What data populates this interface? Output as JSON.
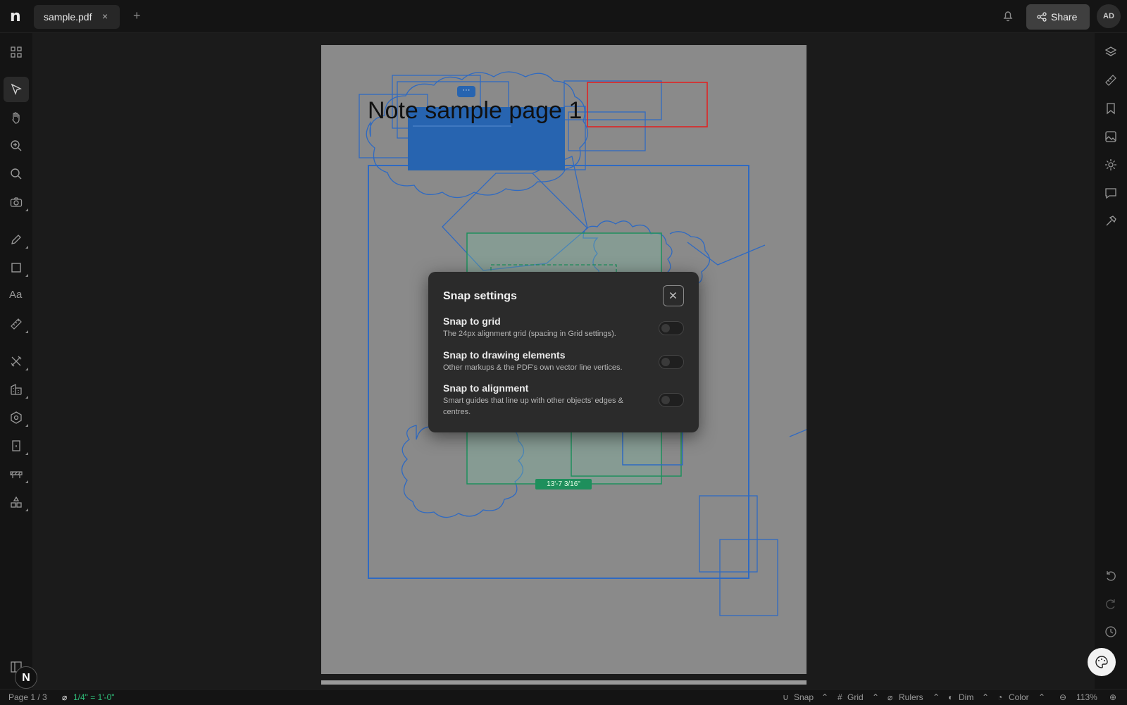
{
  "app": {
    "logo": "n"
  },
  "tabs": [
    {
      "label": "sample.pdf",
      "close": "×"
    }
  ],
  "new_tab": "+",
  "header": {
    "share_label": "Share",
    "avatar_initials": "AD"
  },
  "left_tools": [
    "grid-icon",
    "select-icon",
    "hand-icon",
    "zoom-in-icon",
    "search-icon",
    "camera-icon",
    "pen-icon",
    "rectangle-icon",
    "text-icon",
    "ruler-icon",
    "tools-icon",
    "building-icon",
    "hex-icon",
    "door-icon",
    "barrier-icon",
    "shapes-icon",
    "panel-icon"
  ],
  "right_tools": [
    "layers-icon",
    "ruler-icon",
    "bookmark-icon",
    "image-icon",
    "settings-icon",
    "comment-icon",
    "hammer-icon",
    "undo-icon",
    "redo-icon",
    "history-icon"
  ],
  "page": {
    "title_text": "Note sample page 1",
    "measurement_label": "13'-7 3/16\"",
    "more_label": "···"
  },
  "modal": {
    "title": "Snap settings",
    "close": "×",
    "options": [
      {
        "title": "Snap to grid",
        "description": "The 24px alignment grid (spacing in Grid settings).",
        "enabled": false
      },
      {
        "title": "Snap to drawing elements",
        "description": "Other markups & the PDF's own vector line vertices.",
        "enabled": false
      },
      {
        "title": "Snap to alignment",
        "description": "Smart guides that line up with other objects' edges & centres.",
        "enabled": false
      }
    ]
  },
  "status": {
    "page": "Page 1 / 3",
    "scale": "1/4\" = 1'-0\"",
    "snap": "Snap",
    "grid": "Grid",
    "rulers": "Rulers",
    "dim": "Dim",
    "color": "Color",
    "zoom": "113%"
  },
  "badge": "N",
  "colors": {
    "accent": "#2764b0",
    "markup_blue": "#2f6ac2",
    "markup_green": "#1e8f5c",
    "markup_red": "#e02424"
  }
}
